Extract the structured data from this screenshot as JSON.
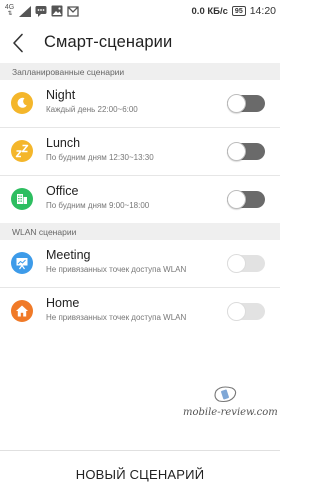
{
  "status_bar": {
    "network_label": "4G",
    "speed": "0.0 КБ/с",
    "battery": "95",
    "time": "14:20"
  },
  "app_bar": {
    "title": "Смарт-сценарии",
    "back_icon": "chevron-left-icon"
  },
  "sections": {
    "scheduled_header": "Запланированные сценарии",
    "wlan_header": "WLAN сценарии"
  },
  "scheduled_items": [
    {
      "title": "Night",
      "subtitle": "Каждый день 22:00~6:00",
      "icon": "moon-icon",
      "icon_color": "#F4B62B",
      "enabled": false,
      "available": true
    },
    {
      "title": "Lunch",
      "subtitle": "По будним дням 12:30~13:30",
      "icon": "sleep-zz-icon",
      "icon_color": "#F4B62B",
      "enabled": false,
      "available": true
    },
    {
      "title": "Office",
      "subtitle": "По будним дням 9:00~18:00",
      "icon": "building-icon",
      "icon_color": "#2DBE60",
      "enabled": false,
      "available": true
    }
  ],
  "wlan_items": [
    {
      "title": "Meeting",
      "subtitle": "Не привязанных точек доступа WLAN",
      "icon": "presentation-board-icon",
      "icon_color": "#3D9BE9",
      "enabled": false,
      "available": false
    },
    {
      "title": "Home",
      "subtitle": "Не привязанных точек доступа WLAN",
      "icon": "house-icon",
      "icon_color": "#F07A28",
      "enabled": false,
      "available": false
    }
  ],
  "watermark": {
    "text": "mobile-review.com"
  },
  "footer": {
    "new_scenario_label": "НОВЫЙ СЦЕНАРИЙ"
  }
}
